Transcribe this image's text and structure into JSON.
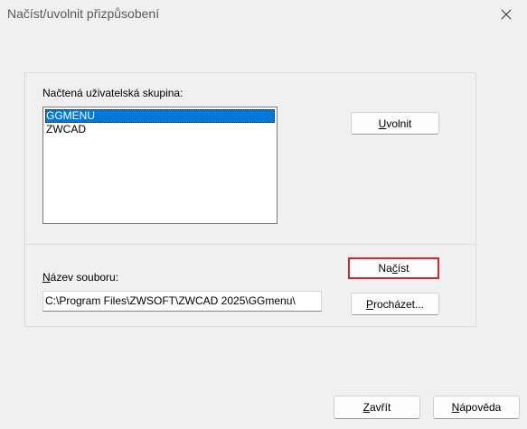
{
  "dialog": {
    "title": "Načíst/uvolnit přizpůsobení",
    "close_icon": "close-icon"
  },
  "group": {
    "loaded_label": "Načtená uživatelská skupina:",
    "items": [
      {
        "label": "GGMENU",
        "selected": true
      },
      {
        "label": "ZWCAD",
        "selected": false
      }
    ],
    "unload_button": {
      "pre": "",
      "key": "U",
      "post": "volnit"
    },
    "filename_label": {
      "pre": "",
      "key": "N",
      "post": "ázev souboru:"
    },
    "filepath_value": "C:\\Program Files\\ZWSOFT\\ZWCAD 2025\\GGmenu\\",
    "load_button": {
      "pre": "Na",
      "key": "č",
      "post": "íst"
    },
    "browse_button": {
      "pre": "",
      "key": "P",
      "post": "rocházet..."
    }
  },
  "footer": {
    "close_button": {
      "pre": "",
      "key": "Z",
      "post": "avřít"
    },
    "help_button": {
      "pre": "",
      "key": "N",
      "post": "ápověda"
    }
  },
  "colors": {
    "selection": "#0078d7",
    "highlight_border": "#e0202a"
  }
}
